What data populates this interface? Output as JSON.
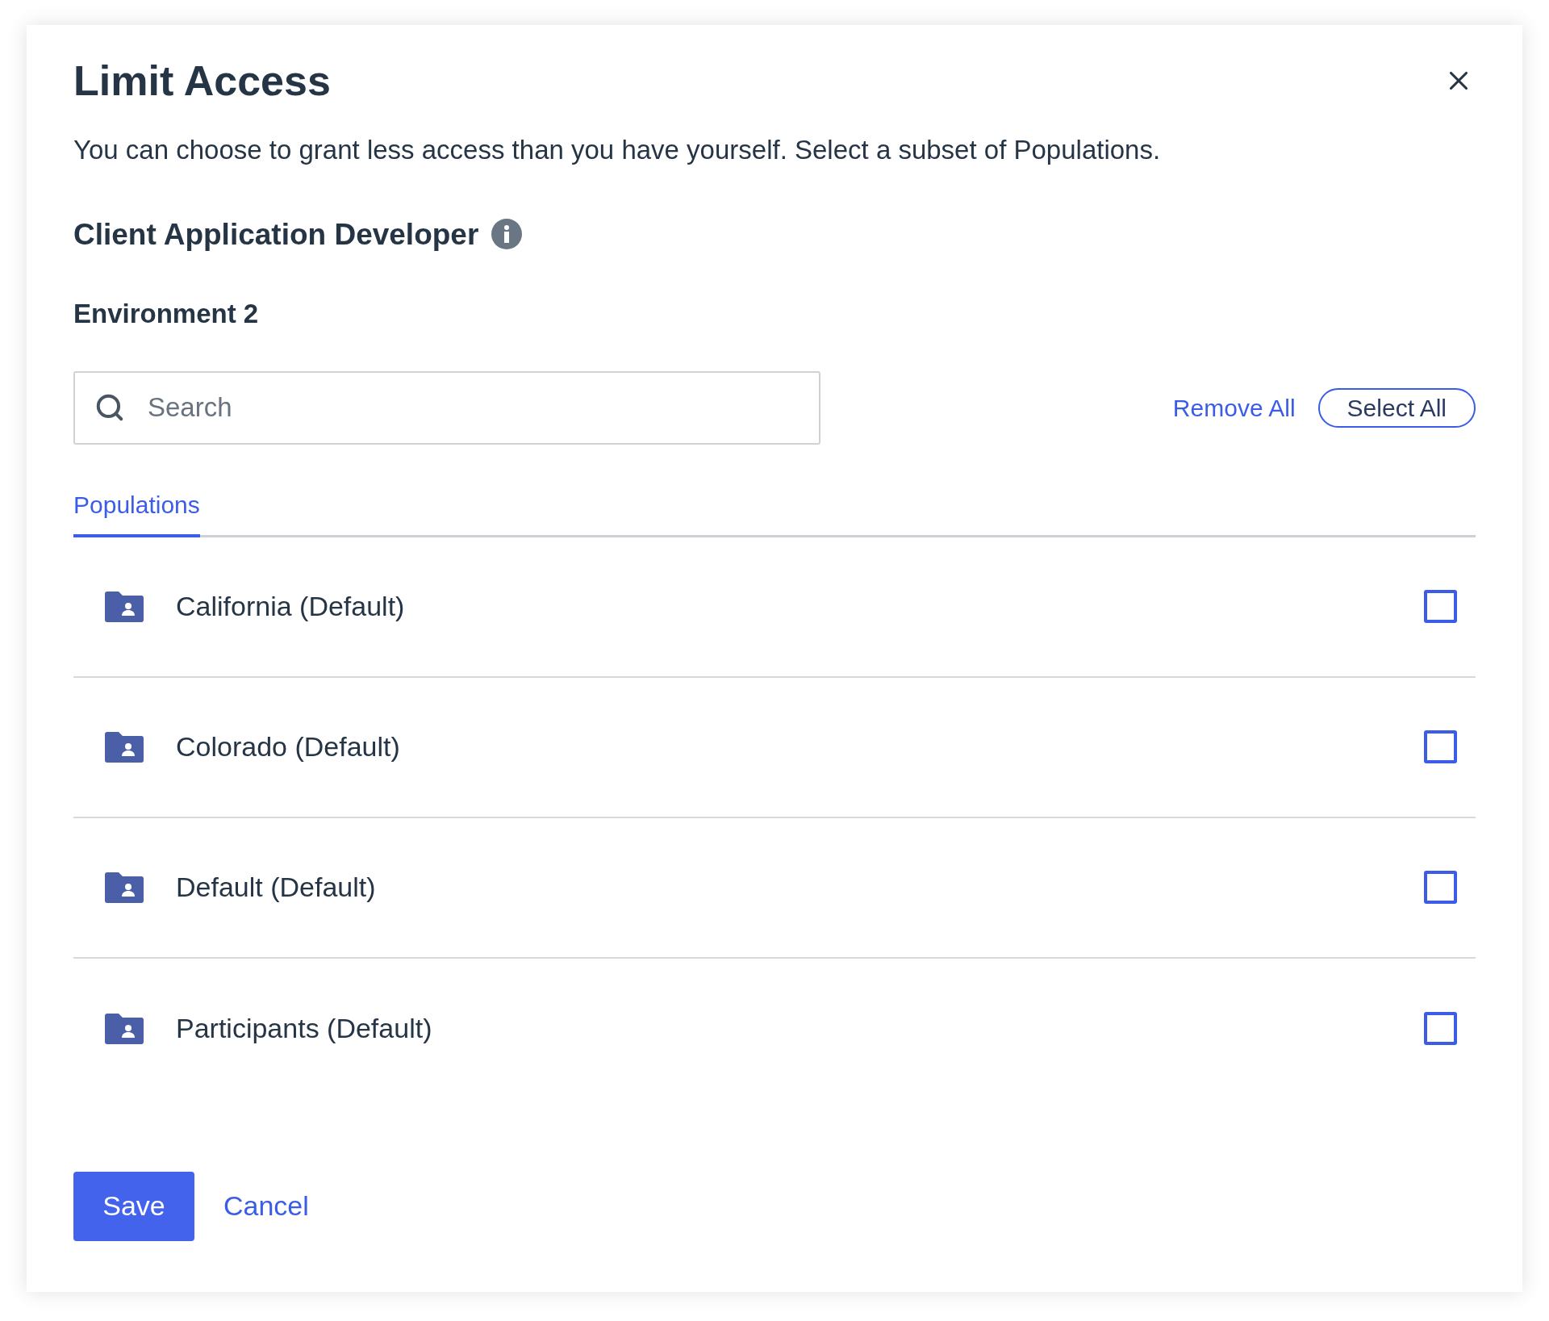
{
  "dialog": {
    "title": "Limit Access",
    "description": "You can choose to grant less access than you have yourself. Select a subset of Populations.",
    "role": "Client Application Developer",
    "environment": "Environment 2"
  },
  "search": {
    "placeholder": "Search"
  },
  "actions": [
    "Remove All",
    "Select All"
  ],
  "tabs": [
    {
      "label": "Populations",
      "selected": true
    }
  ],
  "populations": [
    {
      "name": "California (Default)",
      "checked": false
    },
    {
      "name": "Colorado (Default)",
      "checked": false
    },
    {
      "name": "Default (Default)",
      "checked": false
    },
    {
      "name": "Participants (Default)",
      "checked": false
    }
  ],
  "buttons": [
    "Save",
    "Cancel"
  ]
}
